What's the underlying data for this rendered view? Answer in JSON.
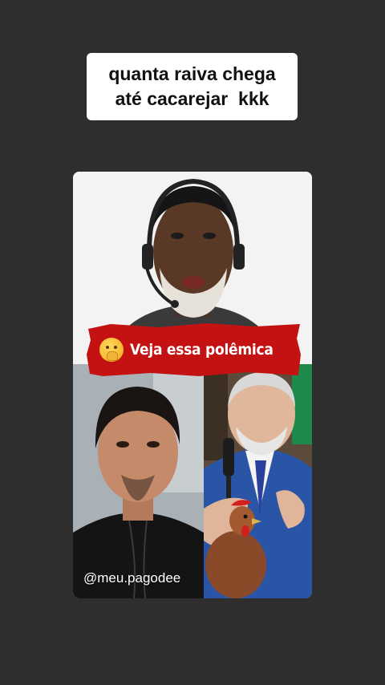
{
  "caption": {
    "line1": "quanta raiva chega",
    "line2": "até cacarejar  kkk"
  },
  "banner": {
    "text": "Veja essa polêmica",
    "emoji": "shushing-face-emoji",
    "color": "#c41212"
  },
  "watermark": {
    "text": "@meu.pagodee"
  },
  "colors": {
    "background": "#2e2e2e",
    "caption_bg": "#ffffff"
  }
}
